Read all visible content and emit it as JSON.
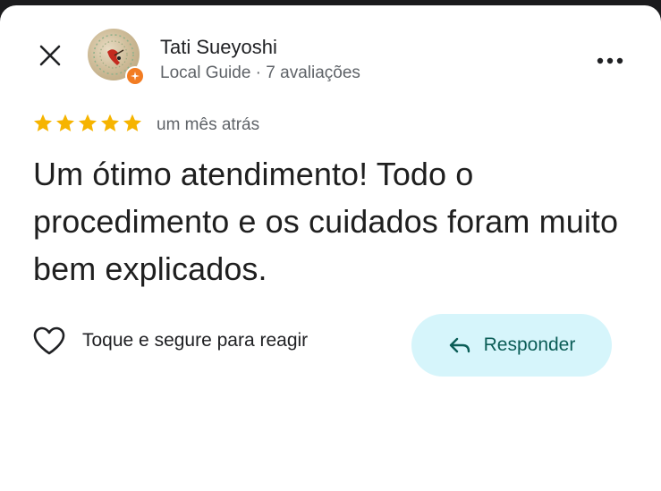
{
  "header": {
    "close_icon": "close-icon",
    "more_icon": "more-vertical-icon"
  },
  "author": {
    "name": "Tati Sueyoshi",
    "meta": "Local Guide · 7 avaliações",
    "badge_color": "#f27c22"
  },
  "review": {
    "rating": 5,
    "rating_max": 5,
    "star_color": "#f6b400",
    "time": "um mês atrás",
    "text": "Um ótimo atendimento! Todo o procedimento e os cuidados foram muito bem explicados."
  },
  "actions": {
    "react_label": "Toque e segure para reagir",
    "reply_label": "Responder",
    "reply_bg": "#d6f5fb",
    "reply_color": "#0b5d57"
  }
}
